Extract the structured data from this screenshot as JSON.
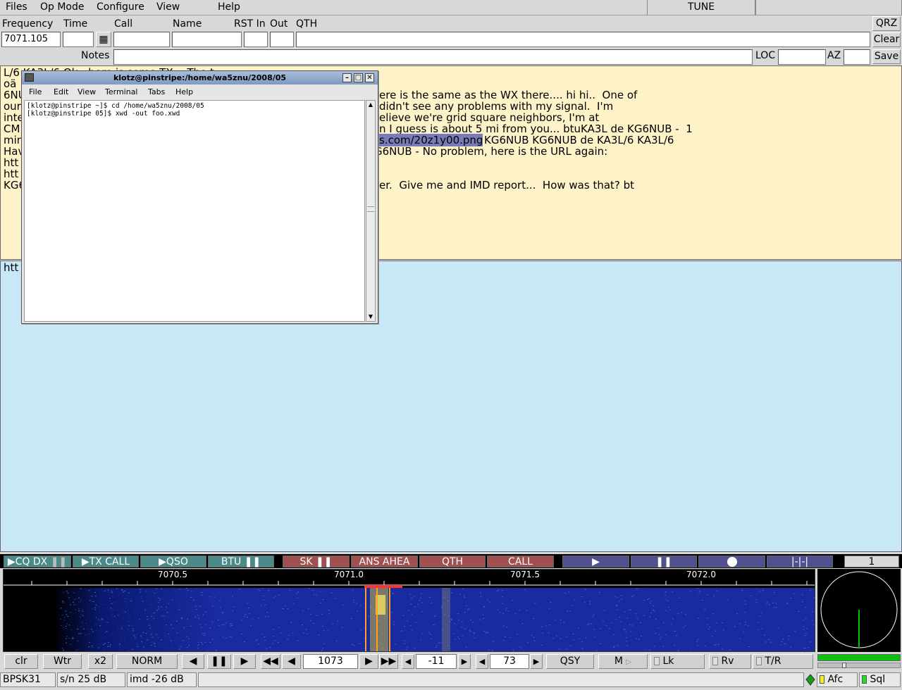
{
  "menubar": {
    "items": [
      "Files",
      "Op Mode",
      "Configure",
      "View",
      "Help"
    ],
    "tune_label": "TUNE"
  },
  "log": {
    "frequency_label": "Frequency",
    "frequency_value": "7071.105",
    "time_label": "Time",
    "time_value": "",
    "call_label": "Call",
    "call_value": "",
    "name_label": "Name",
    "name_value": "",
    "rst_in_label": "RST In",
    "rst_in_value": "",
    "out_label": "Out",
    "out_value": "",
    "qth_label": "QTH",
    "qth_value": "",
    "notes_label": "Notes",
    "notes_value": "",
    "loc_label": "LOC",
    "loc_value": "",
    "az_label": "AZ",
    "az_value": "",
    "qrz_button": "QRZ",
    "clear_button": "Clear",
    "save_button": "Save"
  },
  "rx_text": {
    "left_lines": [
      "L/6 KA3L/6 Ok - here is some TX -  The t",
      "oä",
      "6NU",
      "our",
      "inte",
      "CM",
      "min",
      "Hav",
      "htt",
      "htt",
      "KG6"
    ],
    "right_lines": [
      "ere is the same as the WX there.... hi hi..  One of",
      "didn't see any problems with my signal.  I'm",
      "elieve we're grid square neighbors, I'm at",
      "n I guess is about 5 mi from you... btuKA3L de KG6NUB -  1",
      "G6NUB - No problem, here is the URL again:",
      "er.  Give me and IMD report...  How was that? bt"
    ],
    "highlighted_url": "s.com/20z1y00.png",
    "after_highlight": "KG6NUB KG6NUB de KA3L/6 KA3L/6"
  },
  "tx_text": {
    "line": "htt"
  },
  "terminal": {
    "title": "klotz@pinstripe:/home/wa5znu/2008/05",
    "menu": [
      "File",
      "Edit",
      "View",
      "Terminal",
      "Tabs",
      "Help"
    ],
    "lines": [
      "[klotz@pinstripe ~]$ cd /home/wa5znu/2008/05",
      "[klotz@pinstripe 05]$ xwd -out foo.xwd"
    ]
  },
  "macros": {
    "items": [
      "CQ DX",
      "TX CALL",
      "QSO",
      "BTU",
      "SK",
      "ANS AHEA",
      "QTH",
      "CALL",
      "",
      "",
      "",
      "|-|-|"
    ],
    "page": "1"
  },
  "waterfall": {
    "scale_labels": [
      "7070.5",
      "7071.0",
      "7071.5",
      "7072.0"
    ]
  },
  "controls": {
    "clr": "clr",
    "wtr": "Wtr",
    "x2": "x2",
    "norm": "NORM",
    "freq": "1073",
    "offset": "-11",
    "level": "73",
    "qsy": "QSY",
    "m": "M",
    "lk": "Lk",
    "rv": "Rv",
    "tr": "T/R"
  },
  "status": {
    "mode": "BPSK31",
    "sn": "s/n 25 dB",
    "imd": "imd -26 dB",
    "message": "",
    "afc": "Afc",
    "sql": "Sql"
  }
}
